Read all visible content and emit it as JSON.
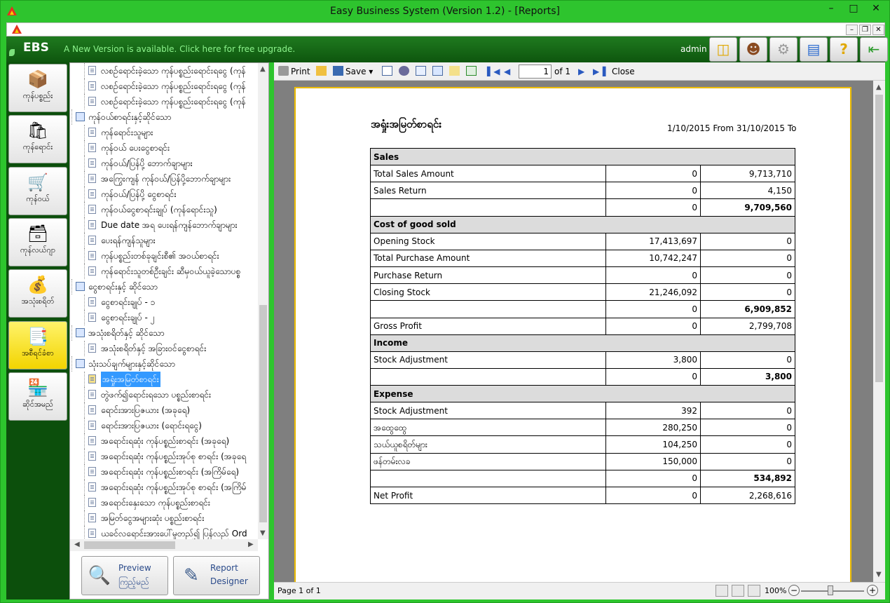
{
  "window": {
    "title": "Easy Business System  (Version 1.2) - [Reports]"
  },
  "topbar": {
    "logo": "EBS",
    "upgrade_link": "A New Version is available. Click here for free upgrade.",
    "user": "admin"
  },
  "toolbar_icons": [
    "database-icon",
    "user-icon",
    "gear-icon",
    "chart-icon",
    "help-icon",
    "exit-icon"
  ],
  "nav": [
    {
      "label": "ကုန်ပစ္စည်း",
      "icon": "box-icon",
      "glyph": "📦"
    },
    {
      "label": "ကုန်ရောင်း",
      "icon": "shopping-bag-icon",
      "glyph": "🛍"
    },
    {
      "label": "ကုန်ဝယ်",
      "icon": "cart-icon",
      "glyph": "🛒"
    },
    {
      "label": "ကုန်လယ်ဂျာ",
      "icon": "cashbox-icon",
      "glyph": "🗃"
    },
    {
      "label": "အသုံးစရိတ်",
      "icon": "cash-register-icon",
      "glyph": "💰"
    },
    {
      "label": "အစီရင်ခံစာ",
      "icon": "reports-icon",
      "glyph": "📑",
      "selected": true
    },
    {
      "label": "ဆိုင်အမည်",
      "icon": "shop-icon",
      "glyph": "🏪"
    }
  ],
  "tree": [
    {
      "level": 1,
      "type": "doc",
      "text": "လစဉ်ရောင်းခဲ့သော ကုန်ပစ္စည်းရောင်းရငွေ (ကုန်"
    },
    {
      "level": 1,
      "type": "doc",
      "text": "လစဉ်ရောင်းခဲ့သော ကုန်ပစ္စည်းရောင်းရငွေ (ကုန်"
    },
    {
      "level": 1,
      "type": "doc",
      "text": "လစဉ်ရောင်းခဲ့သော ကုန်ပစ္စည်းရောင်းရငွေ (ကုန်"
    },
    {
      "level": 0,
      "type": "folder",
      "text": "ကုန်ဝယ်စာရင်းနှင့်ဆိုင်သော"
    },
    {
      "level": 1,
      "type": "doc",
      "text": "ကုန်ရောင်းသူများ"
    },
    {
      "level": 1,
      "type": "doc",
      "text": "ကုန်ဝယ် ပေးငွေစာရင်း"
    },
    {
      "level": 1,
      "type": "doc",
      "text": "ကုန်ဝယ်/ပြန်ပို့ ဘောက်ချာများ"
    },
    {
      "level": 1,
      "type": "doc",
      "text": "အကြွေးကျန် ကုန်ဝယ်/ပြန်ပို့ဘောက်ချာများ"
    },
    {
      "level": 1,
      "type": "doc",
      "text": "ကုန်ဝယ်/ပြန်ပို့ ငွေစာရင်း"
    },
    {
      "level": 1,
      "type": "doc",
      "text": "ကုန်ဝယ်ငွေစာရင်းချုပ် (ကုန်ရောင်းသူ)"
    },
    {
      "level": 1,
      "type": "doc",
      "text": "Due date အရ ပေးရန်ကျန်ဘောက်ချာများ"
    },
    {
      "level": 1,
      "type": "doc",
      "text": "ပေးရန်ကျန်သူများ"
    },
    {
      "level": 1,
      "type": "doc",
      "text": "ကုန်ပစ္စည်းတစ်ခုချင်းစီ၏ အဝယ်စာရင်း"
    },
    {
      "level": 1,
      "type": "doc",
      "text": "ကုန်ရောင်းသူတစ်ဦးချင်း ဆီမှဝယ်ယူခဲ့သောပစ္စ"
    },
    {
      "level": 0,
      "type": "folder",
      "text": "ငွေစာရင်းနှင့် ဆိုင်သော"
    },
    {
      "level": 1,
      "type": "doc",
      "text": "ငွေစာရင်းချုပ် - ၁"
    },
    {
      "level": 1,
      "type": "doc",
      "text": "ငွေစာရင်းချုပ် - ၂"
    },
    {
      "level": 0,
      "type": "folder",
      "text": "အသုံးစရိတ်နှင့် ဆိုင်သော"
    },
    {
      "level": 1,
      "type": "doc",
      "text": "အသုံးစရိတ်နှင့် အခြားဝင်ငွေစာရင်း"
    },
    {
      "level": 0,
      "type": "folder",
      "text": "သုံးသပ်ချက်များနှင့်ဆိုင်သော"
    },
    {
      "level": 1,
      "type": "edit",
      "text": "အရှုံးအမြတ်စာရင်း",
      "selected": true
    },
    {
      "level": 1,
      "type": "doc",
      "text": "တွဲဖက်၍ရောင်းရသော ပစ္စည်းစာရင်း"
    },
    {
      "level": 1,
      "type": "doc",
      "text": "ရောင်းအားပြဇယား (အခုရေ)"
    },
    {
      "level": 1,
      "type": "doc",
      "text": "ရောင်းအားပြဇယား (ရောင်းရငွေ)"
    },
    {
      "level": 1,
      "type": "doc",
      "text": "အရောင်းရဆုံး ကုန်ပစ္စည်းစာရင်း (အခုရေ)"
    },
    {
      "level": 1,
      "type": "doc",
      "text": "အရောင်းရဆုံး ကုန်ပစ္စည်းအုပ်စု စာရင်း (အခုရေ"
    },
    {
      "level": 1,
      "type": "doc",
      "text": "အရောင်းရဆုံး ကုန်ပစ္စည်းစာရင်း (အကြိမ်ရေ)"
    },
    {
      "level": 1,
      "type": "doc",
      "text": "အရောင်းရဆုံး ကုန်ပစ္စည်းအုပ်စု စာရင်း (အကြိမ်"
    },
    {
      "level": 1,
      "type": "doc",
      "text": "အရောင်းနှေးသော ကုန်ပစ္စည်းစာရင်း"
    },
    {
      "level": 1,
      "type": "doc",
      "text": "အမြတ်ငွေအများဆုံး ပစ္စည်းစာရင်း"
    },
    {
      "level": 1,
      "type": "doc",
      "text": "ယခင်လရောင်းအားပေါ်မူတည်၍ ပြန်လည် Ord"
    }
  ],
  "buttons": {
    "preview": {
      "line1": "Preview",
      "line2": "ကြည့်မည်"
    },
    "designer": {
      "line1": "Report",
      "line2": "Designer"
    }
  },
  "report_toolbar": {
    "print": "Print",
    "save": "Save",
    "page_current": "1",
    "page_of": "of 1",
    "close": "Close"
  },
  "report": {
    "title": "အရှုံးအမြတ်စာရင်း",
    "date_range": "1/10/2015 From 31/10/2015 To",
    "rows": [
      {
        "type": "header",
        "label": "Sales"
      },
      {
        "label": "Total Sales Amount",
        "a": "0",
        "b": "9,713,710"
      },
      {
        "label": "Sales Return",
        "a": "0",
        "b": "4,150"
      },
      {
        "label": "",
        "a": "0",
        "b": "9,709,560",
        "bold": true
      },
      {
        "type": "header",
        "label": "Cost of good sold"
      },
      {
        "label": "Opening Stock",
        "a": "17,413,697",
        "b": "0"
      },
      {
        "label": "Total Purchase Amount",
        "a": "10,742,247",
        "b": "0"
      },
      {
        "label": "Purchase Return",
        "a": "0",
        "b": "0"
      },
      {
        "label": "Closing Stock",
        "a": "21,246,092",
        "b": "0"
      },
      {
        "label": "",
        "a": "0",
        "b": "6,909,852",
        "bold": true
      },
      {
        "label": "Gross Profit",
        "a": "0",
        "b": "2,799,708"
      },
      {
        "type": "header",
        "label": "Income"
      },
      {
        "label": "Stock Adjustment",
        "a": "3,800",
        "b": "0"
      },
      {
        "label": "",
        "a": "0",
        "b": "3,800",
        "bold": true
      },
      {
        "type": "header",
        "label": "Expense"
      },
      {
        "label": "Stock Adjustment",
        "a": "392",
        "b": "0"
      },
      {
        "label": "အထွေထွေ",
        "a": "280,250",
        "b": "0"
      },
      {
        "label": "သယ်ယူစရိတ်များ",
        "a": "104,250",
        "b": "0"
      },
      {
        "label": "ဖန်တမ်းလခ",
        "a": "150,000",
        "b": "0"
      },
      {
        "label": "",
        "a": "0",
        "b": "534,892",
        "bold": true
      },
      {
        "label": "Net Profit",
        "a": "0",
        "b": "2,268,616"
      }
    ]
  },
  "status": {
    "page": "Page 1 of 1",
    "zoom": "100%"
  }
}
